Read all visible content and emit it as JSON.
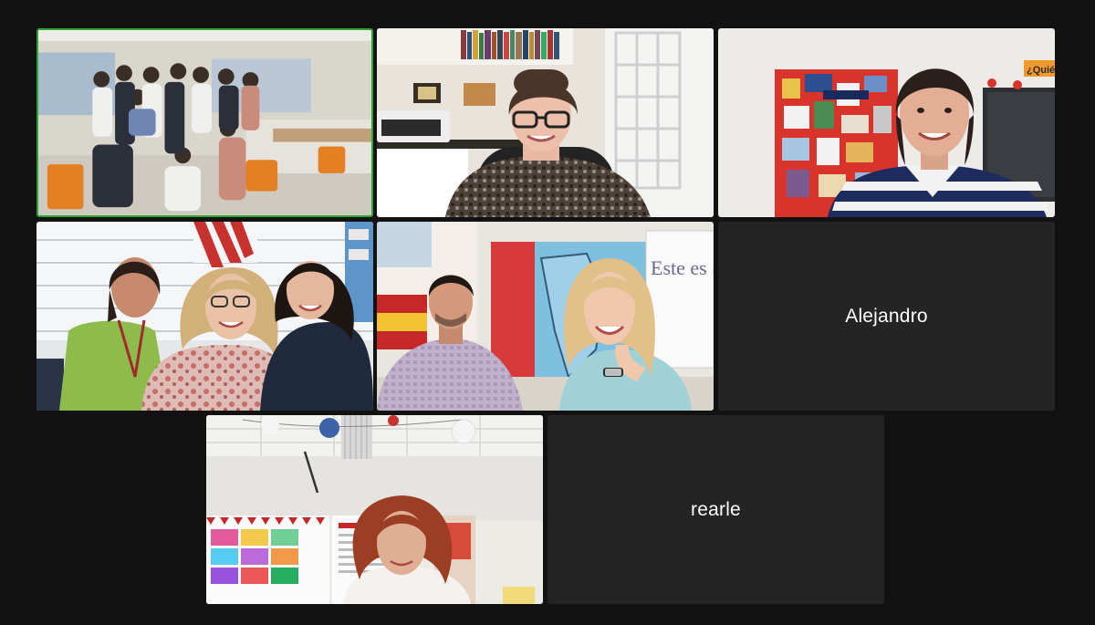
{
  "meeting": {
    "view": "gallery",
    "active_speaker_color": "#2aa52f",
    "tile_background": "#242424",
    "window_background": "#121212"
  },
  "participants": [
    {
      "id": "p1",
      "video_on": true,
      "content": "group of teachers in classroom",
      "active_speaker": true
    },
    {
      "id": "p2",
      "video_on": true,
      "content": "woman with glasses in home office"
    },
    {
      "id": "p3",
      "video_on": true,
      "content": "woman in striped sweater in classroom",
      "wall_sign": "¿Quién"
    },
    {
      "id": "p4",
      "video_on": true,
      "content": "three women in classroom"
    },
    {
      "id": "p5",
      "video_on": true,
      "content": "man and woman in classroom with flag",
      "whiteboard_text": "Este es Se..."
    },
    {
      "id": "p6",
      "video_on": false,
      "name": "Alejandro"
    },
    {
      "id": "p7",
      "video_on": true,
      "content": "woman with auburn hair in classroom"
    },
    {
      "id": "p8",
      "video_on": false,
      "name": "rearle"
    }
  ]
}
